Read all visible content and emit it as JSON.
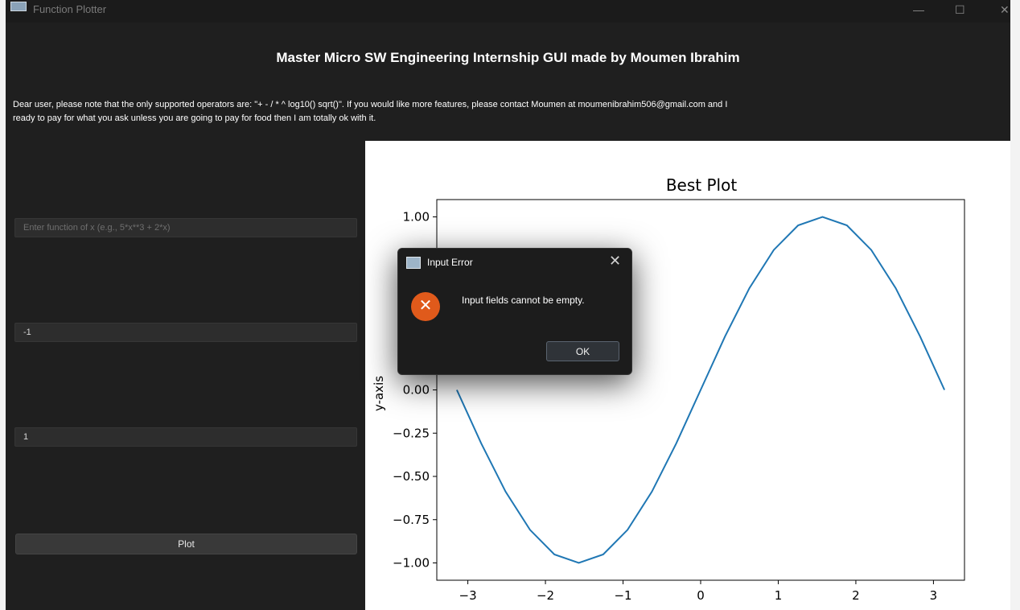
{
  "window": {
    "title": "Function Plotter"
  },
  "header": {
    "title": "Master Micro SW Engineering Internship GUI made by Moumen Ibrahim"
  },
  "notice": {
    "line1": "Dear user, please note that the only supported operators are: \"+ - / * ^ log10() sqrt()\". If you would like more features, please contact Moumen at moumenibrahim506@gmail.com and I",
    "line2": "ready to pay for what you ask unless you are going to pay for food then I am totally ok with it."
  },
  "inputs": {
    "function": {
      "value": "",
      "placeholder": "Enter function of x (e.g., 5*x**3 + 2*x)"
    },
    "min": {
      "value": "-1"
    },
    "max": {
      "value": "1"
    }
  },
  "plot_button": {
    "label": "Plot"
  },
  "dialog": {
    "title": "Input Error",
    "message": "Input fields cannot be empty.",
    "ok_label": "OK"
  },
  "chart_data": {
    "type": "line",
    "title": "Best Plot",
    "ylabel": "y-axis",
    "xlabel": "",
    "function": "sin(x)",
    "xlim": [
      -3.4,
      3.4
    ],
    "ylim": [
      -1.1,
      1.1
    ],
    "x_ticks": [
      -3,
      -2,
      -1,
      0,
      1,
      2,
      3
    ],
    "y_ticks": [
      -1.0,
      -0.75,
      -0.5,
      -0.25,
      0.0,
      0.25,
      0.5,
      0.75,
      1.0
    ],
    "x_tick_labels": [
      "−3",
      "−2",
      "−1",
      "0",
      "1",
      "2",
      "3"
    ],
    "y_tick_labels": [
      "−1.00",
      "−0.75",
      "−0.50",
      "−0.25",
      "0.00",
      "0.25",
      "0.50",
      "0.75",
      "1.00"
    ],
    "series_color": "#1f77b4",
    "series": [
      {
        "x": [
          -3.1416,
          -2.8274,
          -2.5133,
          -2.1991,
          -1.885,
          -1.5708,
          -1.2566,
          -0.9425,
          -0.6283,
          -0.3142,
          0.0,
          0.3142,
          0.6283,
          0.9425,
          1.2566,
          1.5708,
          1.885,
          2.1991,
          2.5133,
          2.8274,
          3.1416
        ],
        "y": [
          0.0,
          -0.309,
          -0.5878,
          -0.809,
          -0.9511,
          -1.0,
          -0.9511,
          -0.809,
          -0.5878,
          -0.309,
          0.0,
          0.309,
          0.5878,
          0.809,
          0.9511,
          1.0,
          0.9511,
          0.809,
          0.5878,
          0.309,
          0.0
        ]
      }
    ]
  }
}
